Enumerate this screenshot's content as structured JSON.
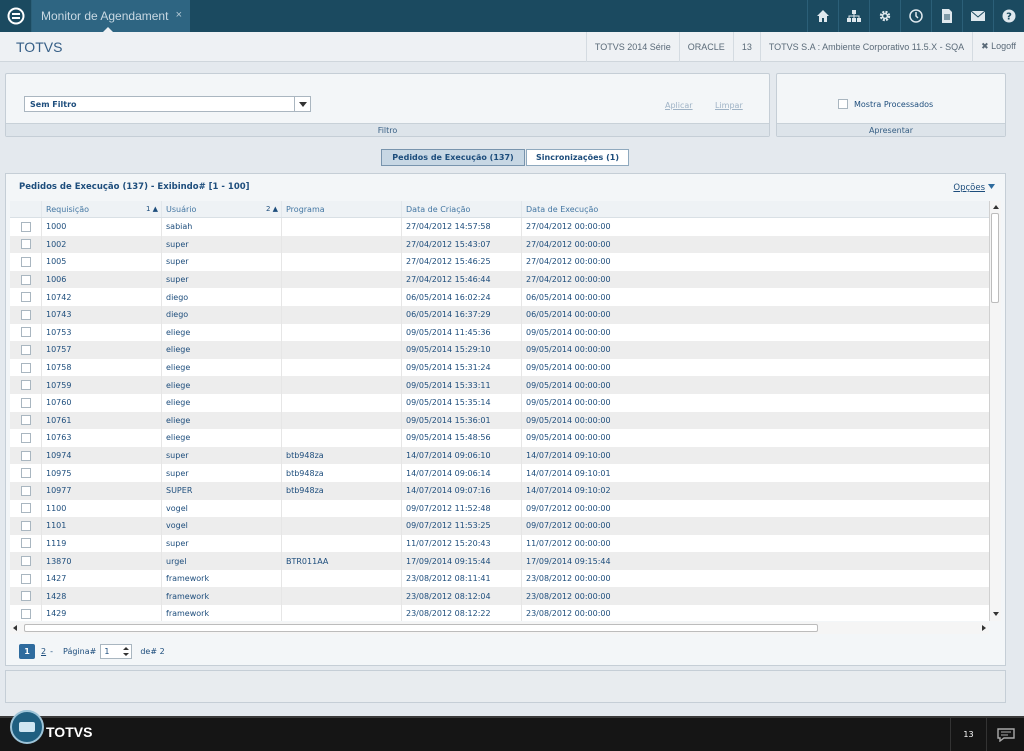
{
  "tab": {
    "title": "Monitor de Agendament",
    "close": "×"
  },
  "top_icons": [
    "home-icon",
    "sitemap-icon",
    "gear-icon",
    "clock-icon",
    "document-icon",
    "mail-icon",
    "help-icon"
  ],
  "header": {
    "brand": "TOTVS",
    "items": [
      "TOTVS 2014 Série",
      "ORACLE",
      "13",
      "TOTVS S.A : Ambiente Corporativo 11.5.X - SQA"
    ],
    "logoff": "✖ Logoff"
  },
  "filter": {
    "select_value": "Sem Filtro",
    "apply": "Aplicar",
    "clear": "Limpar",
    "footer": "Filtro"
  },
  "present": {
    "checkbox_label": "Mostra Processados",
    "footer": "Apresentar"
  },
  "tabs": [
    {
      "label": "Pedidos de Execução (137)",
      "active": true
    },
    {
      "label": "Sincronizações (1)",
      "active": false
    }
  ],
  "grid": {
    "title": "Pedidos de Execução (137) - Exibindo# [1 - 100]",
    "options": "Opções",
    "columns": [
      "Requisição",
      "Usuário",
      "Programa",
      "Data de Criação",
      "Data de Execução"
    ],
    "sort": [
      "1 ▲",
      "2 ▲"
    ],
    "rows": [
      [
        "1000",
        "sabiah",
        "",
        "27/04/2012 14:57:58",
        "27/04/2012 00:00:00"
      ],
      [
        "1002",
        "super",
        "",
        "27/04/2012 15:43:07",
        "27/04/2012 00:00:00"
      ],
      [
        "1005",
        "super",
        "",
        "27/04/2012 15:46:25",
        "27/04/2012 00:00:00"
      ],
      [
        "1006",
        "super",
        "",
        "27/04/2012 15:46:44",
        "27/04/2012 00:00:00"
      ],
      [
        "10742",
        "diego",
        "",
        "06/05/2014 16:02:24",
        "06/05/2014 00:00:00"
      ],
      [
        "10743",
        "diego",
        "",
        "06/05/2014 16:37:29",
        "06/05/2014 00:00:00"
      ],
      [
        "10753",
        "eliege",
        "",
        "09/05/2014 11:45:36",
        "09/05/2014 00:00:00"
      ],
      [
        "10757",
        "eliege",
        "",
        "09/05/2014 15:29:10",
        "09/05/2014 00:00:00"
      ],
      [
        "10758",
        "eliege",
        "",
        "09/05/2014 15:31:24",
        "09/05/2014 00:00:00"
      ],
      [
        "10759",
        "eliege",
        "",
        "09/05/2014 15:33:11",
        "09/05/2014 00:00:00"
      ],
      [
        "10760",
        "eliege",
        "",
        "09/05/2014 15:35:14",
        "09/05/2014 00:00:00"
      ],
      [
        "10761",
        "eliege",
        "",
        "09/05/2014 15:36:01",
        "09/05/2014 00:00:00"
      ],
      [
        "10763",
        "eliege",
        "",
        "09/05/2014 15:48:56",
        "09/05/2014 00:00:00"
      ],
      [
        "10974",
        "super",
        "btb948za",
        "14/07/2014 09:06:10",
        "14/07/2014 09:10:00"
      ],
      [
        "10975",
        "super",
        "btb948za",
        "14/07/2014 09:06:14",
        "14/07/2014 09:10:01"
      ],
      [
        "10977",
        "SUPER",
        "btb948za",
        "14/07/2014 09:07:16",
        "14/07/2014 09:10:02"
      ],
      [
        "1100",
        "vogel",
        "",
        "09/07/2012 11:52:48",
        "09/07/2012 00:00:00"
      ],
      [
        "1101",
        "vogel",
        "",
        "09/07/2012 11:53:25",
        "09/07/2012 00:00:00"
      ],
      [
        "1119",
        "super",
        "",
        "11/07/2012 15:20:43",
        "11/07/2012 00:00:00"
      ],
      [
        "13870",
        "urgel",
        "BTR011AA",
        "17/09/2014 09:15:44",
        "17/09/2014 09:15:44"
      ],
      [
        "1427",
        "framework",
        "",
        "23/08/2012 08:11:41",
        "23/08/2012 00:00:00"
      ],
      [
        "1428",
        "framework",
        "",
        "23/08/2012 08:12:04",
        "23/08/2012 00:00:00"
      ],
      [
        "1429",
        "framework",
        "",
        "23/08/2012 08:12:22",
        "23/08/2012 00:00:00"
      ]
    ]
  },
  "pager": {
    "current": "1",
    "next": "2",
    "sep": "-",
    "label": "Página#",
    "value": "1",
    "of": "de# 2"
  },
  "footer": {
    "brand": "TOTVS",
    "count": "13"
  }
}
